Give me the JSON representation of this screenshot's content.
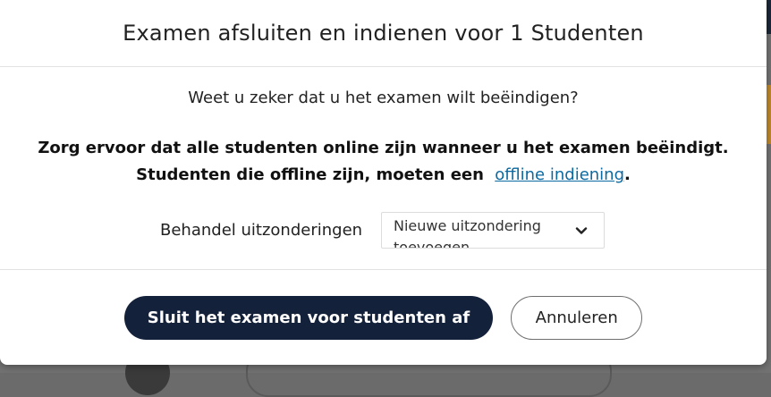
{
  "modal": {
    "title": "Examen afsluiten en indienen voor 1 Studenten",
    "question": "Weet u zeker dat u het examen wilt beëindigen?",
    "warning_text": "Zorg ervoor dat alle studenten online zijn wanneer u het examen beëindigt. Studenten die offline zijn, moeten een",
    "warning_link": "offline indiening",
    "warning_end": ".",
    "exceptions_label": "Behandel uitzonderingen",
    "exceptions_select_value": "Nieuwe uitzondering toevoegen",
    "primary_button": "Sluit het examen voor studenten af",
    "cancel_button": "Annuleren"
  },
  "colors": {
    "primary": "#14213a",
    "link": "#0b6aa2"
  },
  "icons": {
    "select_chevron": "chevron-down-icon"
  }
}
